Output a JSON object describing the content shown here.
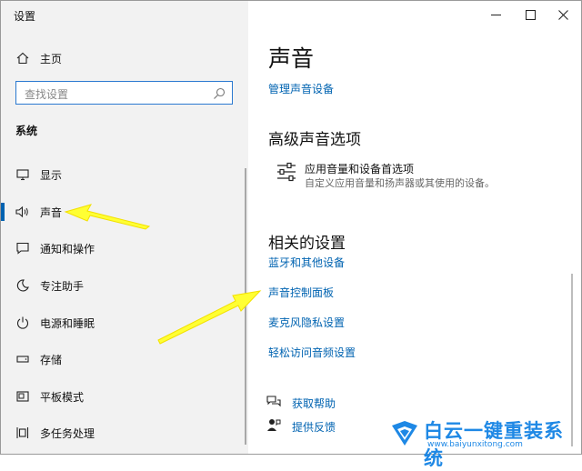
{
  "window": {
    "title": "设置"
  },
  "sidebar": {
    "home_label": "主页",
    "search_placeholder": "查找设置",
    "section": "系统",
    "items": [
      {
        "label": "显示",
        "icon": "monitor-icon"
      },
      {
        "label": "声音",
        "icon": "speaker-icon",
        "active": true
      },
      {
        "label": "通知和操作",
        "icon": "notification-icon"
      },
      {
        "label": "专注助手",
        "icon": "moon-icon"
      },
      {
        "label": "电源和睡眠",
        "icon": "power-icon"
      },
      {
        "label": "存储",
        "icon": "storage-icon"
      },
      {
        "label": "平板模式",
        "icon": "tablet-icon"
      },
      {
        "label": "多任务处理",
        "icon": "multitask-icon"
      }
    ]
  },
  "main": {
    "title": "声音",
    "manage_link": "管理声音设备",
    "advanced_heading": "高级声音选项",
    "app_volume_title": "应用音量和设备首选项",
    "app_volume_desc": "自定义应用音量和扬声器或其使用的设备。",
    "related_heading": "相关的设置",
    "related_links": [
      "蓝牙和其他设备",
      "声音控制面板",
      "麦克风隐私设置",
      "轻松访问音频设置"
    ],
    "help": "获取帮助",
    "feedback": "提供反馈"
  },
  "watermark": {
    "brand": "白云一键重装系统",
    "url": "www.baiyunxitong.com"
  },
  "colors": {
    "accent": "#0063b1",
    "highlight_arrow": "#ffff33",
    "sidebar_bg": "#f2f2f2"
  }
}
